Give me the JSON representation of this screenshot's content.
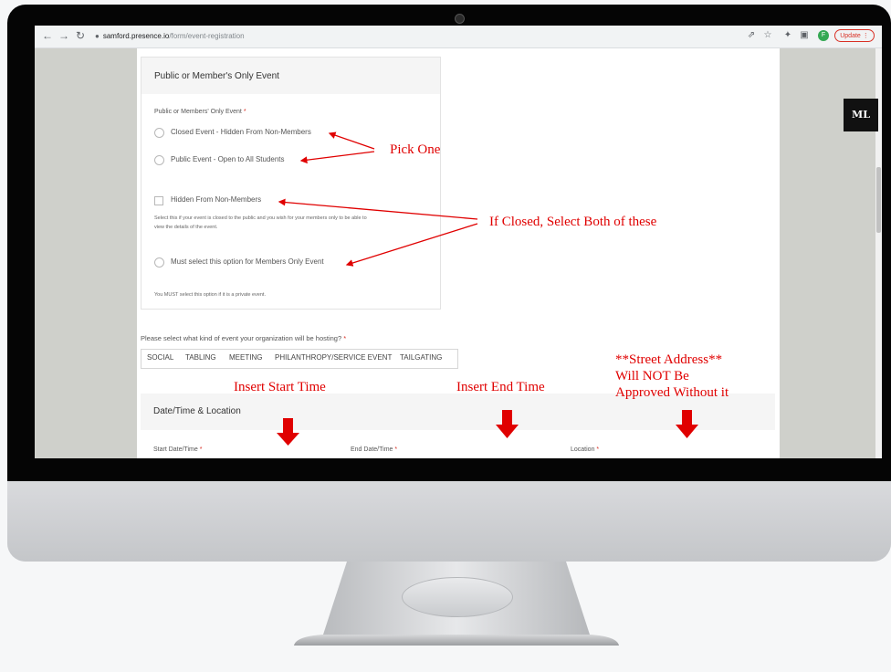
{
  "browser": {
    "url_host": "samford.presence.io",
    "url_path": "/form/event-registration",
    "profile_initial": "F",
    "update_label": "Update"
  },
  "badge_text": "ML",
  "section1": {
    "title": "Public or Member's Only Event",
    "field_label": "Public or Members' Only Event",
    "required_mark": "*",
    "options": [
      {
        "label": "Closed Event - Hidden From Non-Members"
      },
      {
        "label": "Public Event - Open to All Students"
      }
    ],
    "hidden_checkbox_label": "Hidden From Non-Members",
    "hidden_help_line1": "Select this if your event is closed to the public and you wish for your members only to be able to",
    "hidden_help_line2": "view the details of the event.",
    "members_only_label": "Must select this option for Members Only Event",
    "members_only_help": "You MUST select this option if it is a private event."
  },
  "event_type": {
    "question": "Please select what kind of event your organization will be hosting?",
    "required_mark": "*",
    "options": [
      "SOCIAL",
      "TABLING",
      "MEETING",
      "PHILANTHROPY/SERVICE EVENT",
      "TAILGATING"
    ]
  },
  "section2": {
    "title": "Date/Time & Location",
    "start_label": "Start Date/Time",
    "end_label": "End Date/Time",
    "location_label": "Location",
    "required_mark": "*"
  },
  "annotations": {
    "pick_one": "Pick One",
    "if_closed": "If Closed, Select Both of these",
    "insert_start": "Insert Start Time",
    "insert_end": "Insert End Time",
    "street_line1": "**Street Address**",
    "street_line2": "Will NOT Be",
    "street_line3": "Approved Without it"
  },
  "colors": {
    "annotation": "#e00000",
    "required": "#d93025",
    "page_gutter": "#cfd0cb"
  }
}
